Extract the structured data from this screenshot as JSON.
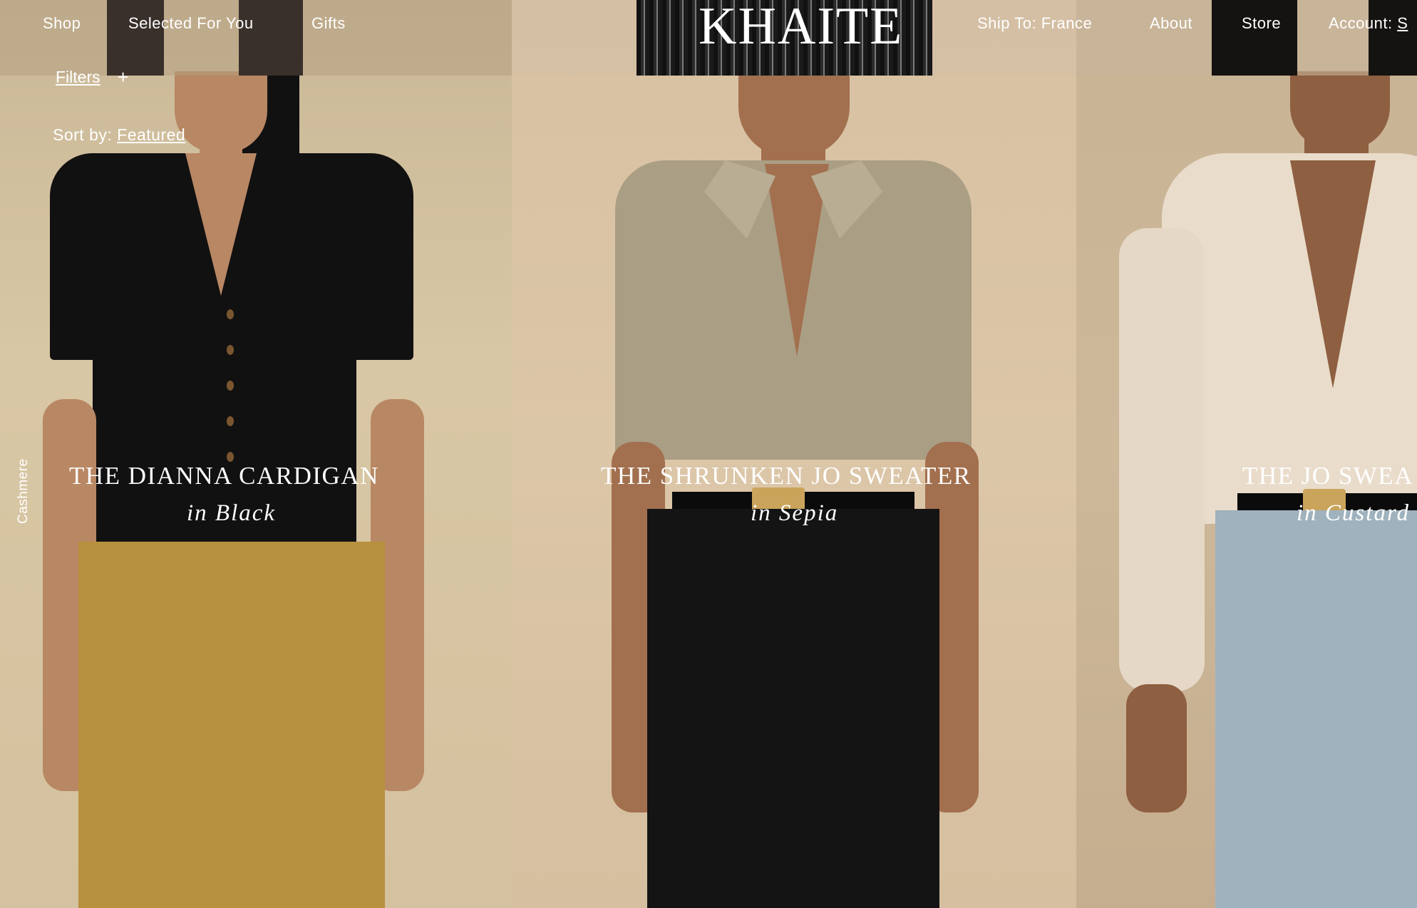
{
  "nav": {
    "left": [
      "Shop",
      "Selected For You",
      "Gifts"
    ],
    "right": [
      "Ship To: France",
      "About",
      "Store"
    ],
    "account_label": "Account:",
    "account_value": "S"
  },
  "brand": {
    "logo": "KHAITE"
  },
  "listing": {
    "filters_label": "Filters",
    "filters_icon": "+",
    "sort_label": "Sort by:",
    "sort_value": "Featured",
    "category": "Cashmere"
  },
  "products": [
    {
      "title": "THE DIANNA CARDIGAN",
      "color": "in Black"
    },
    {
      "title": "THE SHRUNKEN JO SWEATER",
      "color": "in Sepia"
    },
    {
      "title": "THE JO SWEA",
      "color": "in Custard"
    }
  ],
  "colors": {
    "background": "#d8c7a6",
    "text": "#ffffff"
  }
}
